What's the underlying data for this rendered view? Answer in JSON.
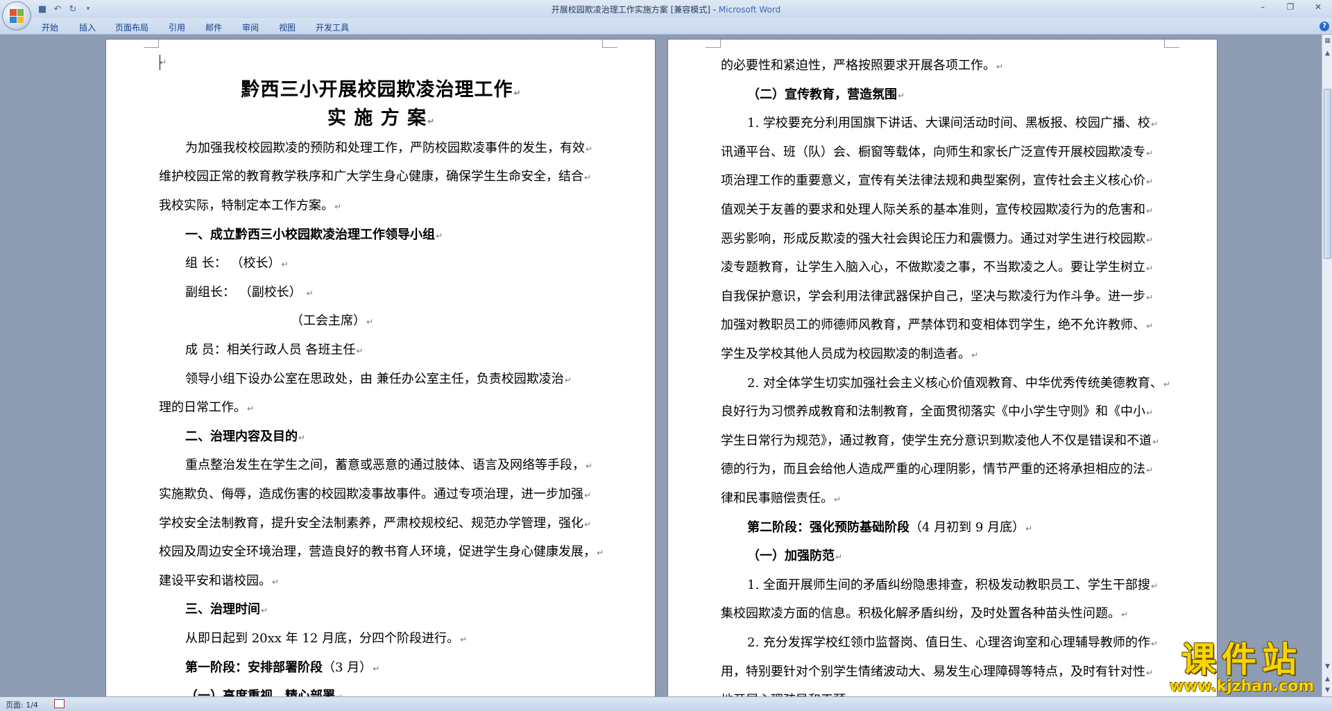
{
  "window": {
    "title": "开展校园欺凌治理工作实施方案 [兼容模式] - ",
    "app_name": "Microsoft Word",
    "minimize": "–",
    "maximize": "❐",
    "close": "✕"
  },
  "ribbon_tabs": [
    "开始",
    "插入",
    "页面布局",
    "引用",
    "邮件",
    "审阅",
    "视图",
    "开发工具"
  ],
  "left_page": [
    {
      "text": "",
      "style": "normal",
      "indent": 0
    },
    {
      "text": "黔西三小开展校园欺凌治理工作",
      "style": "title",
      "indent": 0
    },
    {
      "text": "实  施  方  案",
      "style": "title",
      "indent": 0
    },
    {
      "text": "为加强我校校园欺凌的预防和处理工作，严防校园欺凌事件的发生，有效",
      "style": "normal",
      "indent": 1
    },
    {
      "text": "维护校园正常的教育教学秩序和广大学生身心健康，确保学生生命安全，结合",
      "style": "normal",
      "indent": 0
    },
    {
      "text": "我校实际，特制定本工作方案。",
      "style": "normal",
      "indent": 0
    },
    {
      "text": "一、成立黔西三小校园欺凌治理工作领导小组",
      "style": "bold",
      "indent": 1
    },
    {
      "text": "组    长：  （校长）",
      "style": "normal",
      "indent": 1
    },
    {
      "text": "副组长：  （副校长）    ",
      "style": "normal",
      "indent": 1
    },
    {
      "text": "（工会主席）",
      "style": "normal",
      "indent": 5
    },
    {
      "text": "成    员：相关行政人员    各班主任",
      "style": "normal",
      "indent": 1
    },
    {
      "text": "领导小组下设办公室在思政处，由        兼任办公室主任，负责校园欺凌治",
      "style": "normal",
      "indent": 1
    },
    {
      "text": "理的日常工作。",
      "style": "normal",
      "indent": 0
    },
    {
      "text": "二、治理内容及目的",
      "style": "bold",
      "indent": 1
    },
    {
      "text": "重点整治发生在学生之间，蓄意或恶意的通过肢体、语言及网络等手段，",
      "style": "normal",
      "indent": 1
    },
    {
      "text": "实施欺负、侮辱，造成伤害的校园欺凌事故事件。通过专项治理，进一步加强",
      "style": "normal",
      "indent": 0
    },
    {
      "text": "学校安全法制教育，提升安全法制素养，严肃校规校纪、规范办学管理，强化",
      "style": "normal",
      "indent": 0
    },
    {
      "text": "校园及周边安全环境治理，营造良好的教书育人环境，促进学生身心健康发展，",
      "style": "normal",
      "indent": 0
    },
    {
      "text": "建设平安和谐校园。",
      "style": "normal",
      "indent": 0
    },
    {
      "text": "三、治理时间",
      "style": "bold",
      "indent": 1
    },
    {
      "text": "从即日起到 20xx 年 12 月底，分四个阶段进行。",
      "style": "normal",
      "indent": 1
    },
    {
      "text": "第一阶段：安排部署阶段",
      "suffix": "（3 月）",
      "style": "bold",
      "indent": 1
    },
    {
      "text": "（一）高度重视，精心部署",
      "style": "bold",
      "indent": 1
    }
  ],
  "right_page": [
    {
      "text": "的必要性和紧迫性，严格按照要求开展各项工作。",
      "style": "normal",
      "indent": 0
    },
    {
      "text": "（二）宣传教育，营造氛围",
      "style": "bold",
      "indent": 1
    },
    {
      "text": "1. 学校要充分利用国旗下讲话、大课间活动时间、黑板报、校园广播、校",
      "style": "normal",
      "indent": 1
    },
    {
      "text": "讯通平台、班（队）会、橱窗等载体，向师生和家长广泛宣传开展校园欺凌专",
      "style": "normal",
      "indent": 0
    },
    {
      "text": "项治理工作的重要意义，宣传有关法律法规和典型案例，宣传社会主义核心价",
      "style": "normal",
      "indent": 0
    },
    {
      "text": "值观关于友善的要求和处理人际关系的基本准则，宣传校园欺凌行为的危害和",
      "style": "normal",
      "indent": 0
    },
    {
      "text": "恶劣影响，形成反欺凌的强大社会舆论压力和震慑力。通过对学生进行校园欺",
      "style": "normal",
      "indent": 0
    },
    {
      "text": "凌专题教育，让学生入脑入心，不做欺凌之事，不当欺凌之人。要让学生树立",
      "style": "normal",
      "indent": 0
    },
    {
      "text": "自我保护意识，学会利用法律武器保护自己，坚决与欺凌行为作斗争。进一步",
      "style": "normal",
      "indent": 0
    },
    {
      "text": "加强对教职员工的师德师风教育，严禁体罚和变相体罚学生，绝不允许教师、",
      "style": "normal",
      "indent": 0
    },
    {
      "text": "学生及学校其他人员成为校园欺凌的制造者。",
      "style": "normal",
      "indent": 0
    },
    {
      "text": "2. 对全体学生切实加强社会主义核心价值观教育、中华优秀传统美德教育、",
      "style": "normal",
      "indent": 1
    },
    {
      "text": "良好行为习惯养成教育和法制教育，全面贯彻落实《中小学生守则》和《中小",
      "style": "normal",
      "indent": 0
    },
    {
      "text": "学生日常行为规范》，通过教育，使学生充分意识到欺凌他人不仅是错误和不道",
      "style": "normal",
      "indent": 0
    },
    {
      "text": "德的行为，而且会给他人造成严重的心理阴影，情节严重的还将承担相应的法",
      "style": "normal",
      "indent": 0
    },
    {
      "text": "律和民事赔偿责任。",
      "style": "normal",
      "indent": 0
    },
    {
      "text": "第二阶段：强化预防基础阶段",
      "suffix": "（4 月初到 9 月底）",
      "style": "bold",
      "indent": 1
    },
    {
      "text": "（一）加强防范",
      "style": "bold",
      "indent": 1
    },
    {
      "text": "1. 全面开展师生间的矛盾纠纷隐患排查，积极发动教职员工、学生干部搜",
      "style": "normal",
      "indent": 1
    },
    {
      "text": "集校园欺凌方面的信息。积极化解矛盾纠纷，及时处置各种苗头性问题。",
      "style": "normal",
      "indent": 0
    },
    {
      "text": "2. 充分发挥学校红领巾监督岗、值日生、心理咨询室和心理辅导教师的作",
      "style": "normal",
      "indent": 1
    },
    {
      "text": "用，特别要针对个别学生情绪波动大、易发生心理障碍等特点，及时有针对性",
      "style": "normal",
      "indent": 0
    },
    {
      "text": "地开展心理疏导和干预。",
      "style": "normal",
      "indent": 0
    }
  ],
  "status": {
    "page_info": "页面: 1/4"
  },
  "watermark": {
    "main": "课件站",
    "url": "www.kjzhan.com"
  },
  "colors": {
    "ribbon_text": "#15428b",
    "doc_background": "#8e9cb4",
    "watermark_yellow": "#f7d600"
  }
}
